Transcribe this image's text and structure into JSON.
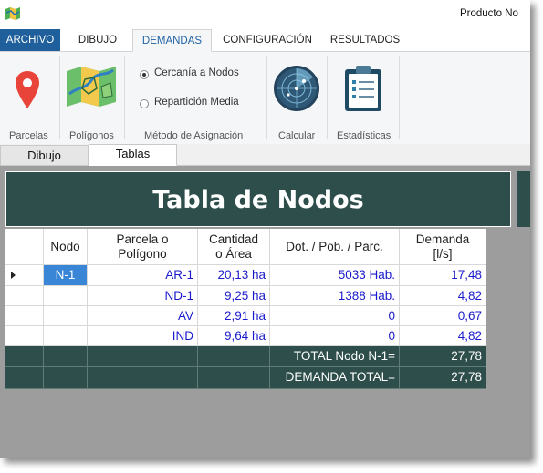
{
  "window": {
    "title": "Producto No"
  },
  "ribbon_tabs": [
    "ARCHIVO",
    "DIBUJO",
    "DEMANDAS",
    "CONFIGURACIÓN",
    "RESULTADOS"
  ],
  "ribbon": {
    "parcelas_label": "Parcelas",
    "poligonos_label": "Polígonos",
    "metodo": {
      "group_label": "Método de Asignación",
      "options": [
        "Cercanía a Nodos",
        "Repartición Media"
      ],
      "selected": "Cercanía a Nodos"
    },
    "calcular_label": "Calcular",
    "estadisticas_label": "Estadísticas"
  },
  "doc_tabs": [
    "Dibujo",
    "Tablas"
  ],
  "active_doc_tab": "Tablas",
  "table": {
    "title": "Tabla de Nodos",
    "columns": [
      [
        "Nodo"
      ],
      [
        "Parcela o",
        "Polígono"
      ],
      [
        "Cantidad",
        "o Área"
      ],
      [
        "Dot. / Pob. / Parc."
      ],
      [
        "Demanda",
        "[l/s]"
      ]
    ],
    "rows": [
      {
        "nodo": "N-1",
        "parcela": "AR-1",
        "area": "20,13 ha",
        "dot": "5033 Hab.",
        "demanda": "17,48"
      },
      {
        "nodo": "",
        "parcela": "ND-1",
        "area": "9,25 ha",
        "dot": "1388 Hab.",
        "demanda": "4,82"
      },
      {
        "nodo": "",
        "parcela": "AV",
        "area": "2,91 ha",
        "dot": "0",
        "demanda": "0,67"
      },
      {
        "nodo": "",
        "parcela": "IND",
        "area": "9,64 ha",
        "dot": "0",
        "demanda": "4,82"
      }
    ],
    "totals": [
      {
        "label": "TOTAL Nodo N-1=",
        "value": "27,78"
      },
      {
        "label": "DEMANDA TOTAL=",
        "value": "27,78"
      }
    ]
  },
  "colors": {
    "file_tab": "#1e5f9c",
    "active_tab_text": "#2063a6",
    "table_dark": "#2d4e4b",
    "value_blue": "#1a1acc",
    "selection": "#3a86d6"
  }
}
